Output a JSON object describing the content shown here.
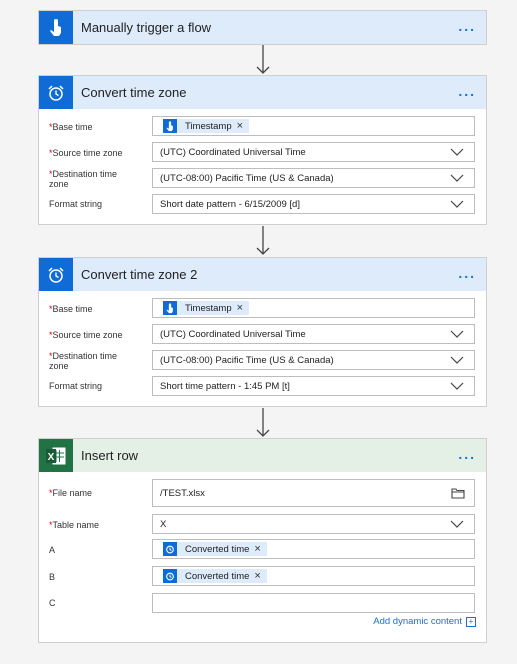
{
  "trigger": {
    "title": "Manually trigger a flow",
    "icon": "hand-touch-icon"
  },
  "step1": {
    "title": "Convert time zone",
    "base_time_label": "Base time",
    "base_time_token": "Timestamp",
    "source_label": "Source time zone",
    "source_value": "(UTC) Coordinated Universal Time",
    "dest_label_1": "Destination time",
    "dest_label_2": "zone",
    "dest_value": "(UTC-08:00) Pacific Time (US & Canada)",
    "format_label": "Format string",
    "format_value": "Short date pattern - 6/15/2009 [d]"
  },
  "step2": {
    "title": "Convert time zone 2",
    "base_time_label": "Base time",
    "base_time_token": "Timestamp",
    "source_label": "Source time zone",
    "source_value": "(UTC) Coordinated Universal Time",
    "dest_label_1": "Destination time",
    "dest_label_2": "zone",
    "dest_value": "(UTC-08:00) Pacific Time (US & Canada)",
    "format_label": "Format string",
    "format_value": "Short time pattern - 1:45 PM [t]"
  },
  "step3": {
    "title": "Insert row",
    "file_label": "File name",
    "file_value": "/TEST.xlsx",
    "table_label": "Table name",
    "table_value": "X",
    "a_label": "A",
    "a_token": "Converted time",
    "b_label": "B",
    "b_token": "Converted time",
    "c_label": "C",
    "c_value": "",
    "dynamic_link": "Add dynamic content"
  },
  "more_label": "...",
  "required_mark": "*",
  "colors": {
    "accent": "#0f6cd6",
    "excel": "#217346",
    "header_blue": "#ddebfa",
    "header_green": "#e4efe5"
  }
}
